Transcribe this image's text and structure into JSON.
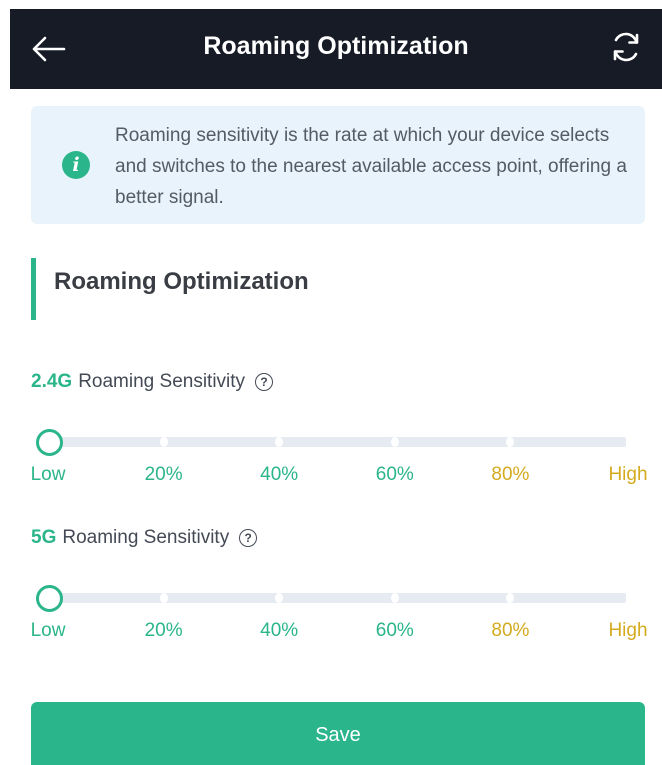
{
  "header": {
    "title": "Roaming Optimization",
    "back_icon": "arrow-left-icon",
    "refresh_icon": "refresh-icon"
  },
  "info": {
    "icon": "info-icon",
    "icon_glyph": "i",
    "text": "Roaming sensitivity is the rate at which your device selects and switches to the nearest available access point, offering a better signal."
  },
  "section": {
    "title": "Roaming Optimization"
  },
  "sliders": [
    {
      "band": "2.4G",
      "label": "Roaming Sensitivity",
      "help_glyph": "?",
      "value": "Low",
      "ticks": [
        "Low",
        "20%",
        "40%",
        "60%",
        "80%",
        "High"
      ]
    },
    {
      "band": "5G",
      "label": "Roaming Sensitivity",
      "help_glyph": "?",
      "value": "Low",
      "ticks": [
        "Low",
        "20%",
        "40%",
        "60%",
        "80%",
        "High"
      ]
    }
  ],
  "save_button": {
    "label": "Save"
  },
  "colors": {
    "header_bg": "#161b26",
    "accent": "#2bb58a",
    "accent_gold": "#d4aa1f",
    "info_bg": "#e8f3fb"
  }
}
